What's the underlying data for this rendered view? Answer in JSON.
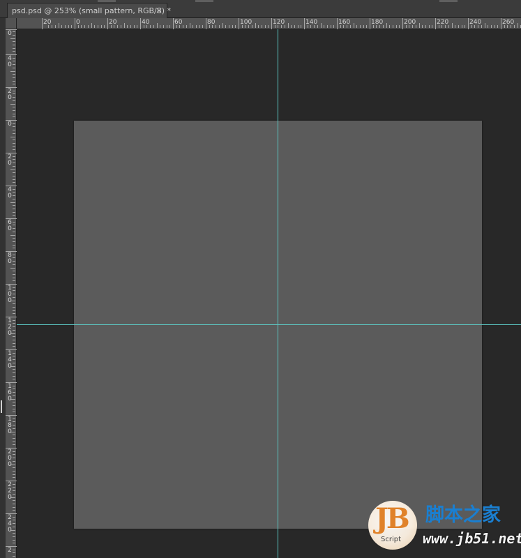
{
  "document_tab": {
    "title": "psd.psd @ 253% (small pattern, RGB/8) *",
    "close_glyph": "×"
  },
  "rulers": {
    "horizontal_labels": [
      "20",
      "0",
      "20",
      "40",
      "60",
      "80",
      "100",
      "120",
      "140",
      "160",
      "180",
      "200",
      "220",
      "240",
      "260"
    ],
    "vertical_labels": [
      "0",
      "40",
      "20",
      "0",
      "20",
      "40",
      "60",
      "80",
      "100",
      "120",
      "140",
      "160",
      "180",
      "200",
      "220",
      "240",
      "2"
    ]
  },
  "canvas": {
    "zoom_percent": 253,
    "document_name": "psd.psd",
    "layer_name": "small pattern",
    "color_mode": "RGB/8",
    "background_color": "#282828",
    "document_color": "#5b5b5b",
    "guide_color": "#5cc7c3",
    "guides": {
      "vertical_at": 120,
      "horizontal_at": 120
    }
  },
  "watermark": {
    "logo_text": "JB",
    "logo_subtext": "Script",
    "site_name_cn": "脚本之家",
    "site_url": "www.jb51.net",
    "logo_color": "#e0822a",
    "name_color": "#1a7fd1"
  }
}
